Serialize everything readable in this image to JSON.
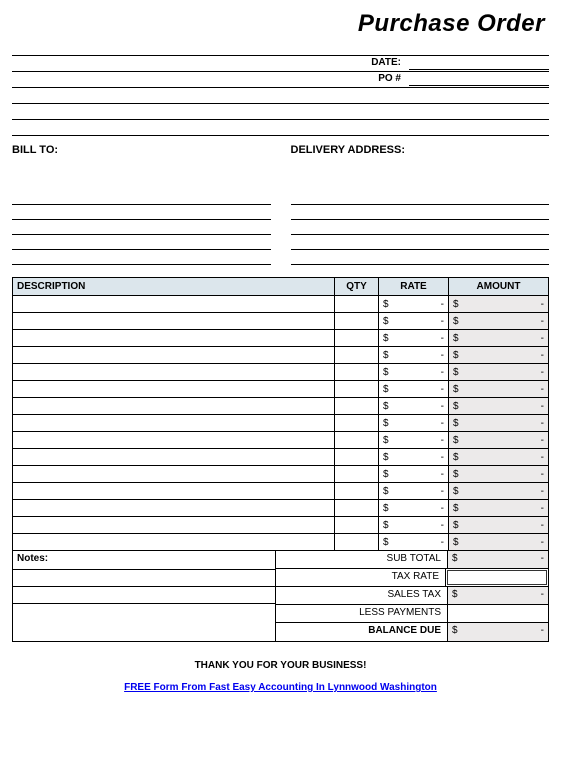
{
  "title": "Purchase Order",
  "date_label": "DATE:",
  "po_label": "PO #",
  "date_value": "",
  "po_value": "",
  "bill_to_label": "BILL TO:",
  "delivery_label": "DELIVERY ADDRESS:",
  "columns": {
    "description": "DESCRIPTION",
    "qty": "QTY",
    "rate": "RATE",
    "amount": "AMOUNT"
  },
  "line_items": [
    {
      "desc": "",
      "qty": "",
      "rate_sym": "$",
      "rate_val": "-",
      "amt_sym": "$",
      "amt_val": "-"
    },
    {
      "desc": "",
      "qty": "",
      "rate_sym": "$",
      "rate_val": "-",
      "amt_sym": "$",
      "amt_val": "-"
    },
    {
      "desc": "",
      "qty": "",
      "rate_sym": "$",
      "rate_val": "-",
      "amt_sym": "$",
      "amt_val": "-"
    },
    {
      "desc": "",
      "qty": "",
      "rate_sym": "$",
      "rate_val": "-",
      "amt_sym": "$",
      "amt_val": "-"
    },
    {
      "desc": "",
      "qty": "",
      "rate_sym": "$",
      "rate_val": "-",
      "amt_sym": "$",
      "amt_val": "-"
    },
    {
      "desc": "",
      "qty": "",
      "rate_sym": "$",
      "rate_val": "-",
      "amt_sym": "$",
      "amt_val": "-"
    },
    {
      "desc": "",
      "qty": "",
      "rate_sym": "$",
      "rate_val": "-",
      "amt_sym": "$",
      "amt_val": "-"
    },
    {
      "desc": "",
      "qty": "",
      "rate_sym": "$",
      "rate_val": "-",
      "amt_sym": "$",
      "amt_val": "-"
    },
    {
      "desc": "",
      "qty": "",
      "rate_sym": "$",
      "rate_val": "-",
      "amt_sym": "$",
      "amt_val": "-"
    },
    {
      "desc": "",
      "qty": "",
      "rate_sym": "$",
      "rate_val": "-",
      "amt_sym": "$",
      "amt_val": "-"
    },
    {
      "desc": "",
      "qty": "",
      "rate_sym": "$",
      "rate_val": "-",
      "amt_sym": "$",
      "amt_val": "-"
    },
    {
      "desc": "",
      "qty": "",
      "rate_sym": "$",
      "rate_val": "-",
      "amt_sym": "$",
      "amt_val": "-"
    },
    {
      "desc": "",
      "qty": "",
      "rate_sym": "$",
      "rate_val": "-",
      "amt_sym": "$",
      "amt_val": "-"
    },
    {
      "desc": "",
      "qty": "",
      "rate_sym": "$",
      "rate_val": "-",
      "amt_sym": "$",
      "amt_val": "-"
    },
    {
      "desc": "",
      "qty": "",
      "rate_sym": "$",
      "rate_val": "-",
      "amt_sym": "$",
      "amt_val": "-"
    }
  ],
  "notes_label": "Notes:",
  "totals": {
    "sub_total_label": "SUB TOTAL",
    "sub_total_sym": "$",
    "sub_total_val": "-",
    "tax_rate_label": "TAX RATE",
    "tax_rate_val": "",
    "sales_tax_label": "SALES TAX",
    "sales_tax_sym": "$",
    "sales_tax_val": "-",
    "less_pay_label": "LESS PAYMENTS",
    "less_pay_val": "",
    "balance_label": "BALANCE DUE",
    "balance_sym": "$",
    "balance_val": "-"
  },
  "thanks": "THANK YOU FOR YOUR BUSINESS!",
  "footer_link_text": "FREE Form From Fast Easy Accounting In Lynnwood Washington"
}
